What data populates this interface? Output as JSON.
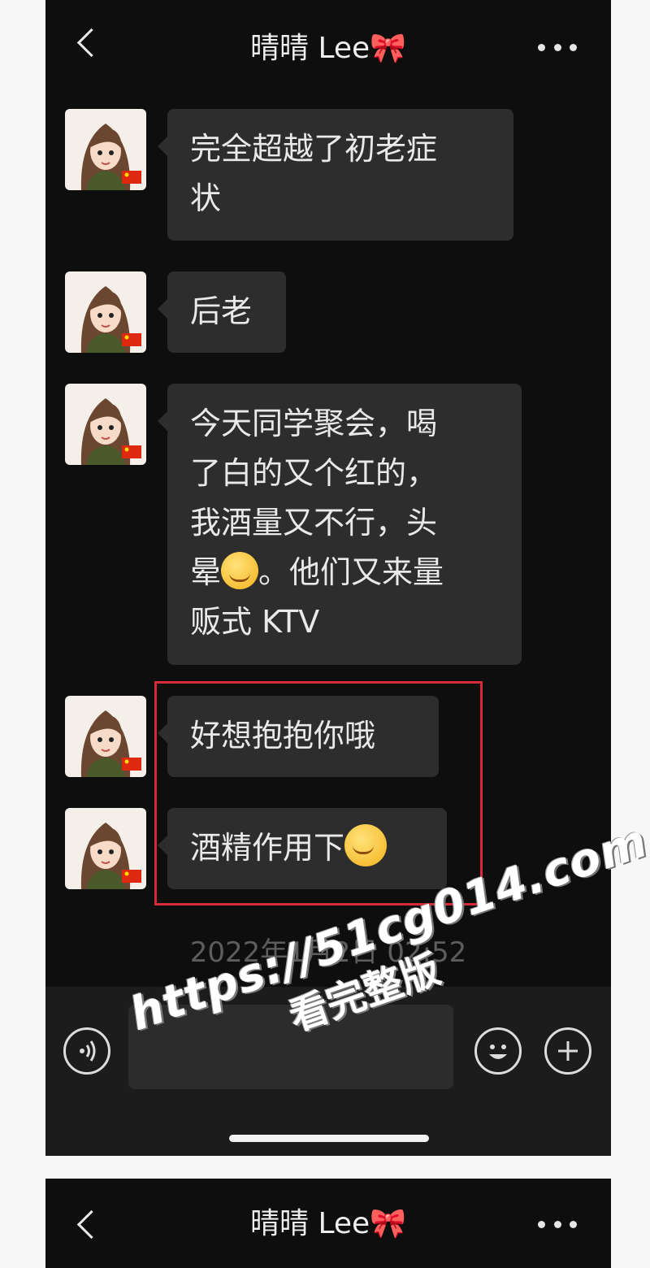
{
  "chat": {
    "title": "晴晴 Lee🎀",
    "messages": [
      {
        "text": "完全超越了初老症\n状"
      },
      {
        "text": "后老"
      },
      {
        "text_before": "今天同学聚会，喝\n了白的又个红的，\n我酒量又不行，头\n晕",
        "emoji": "dizzy-face-emoji",
        "text_after": "。他们又来量\n贩式 KTV"
      },
      {
        "text": "好想抱抱你哦"
      },
      {
        "text": "酒精作用下",
        "emoji": "blushing-smile-emoji"
      }
    ],
    "timestamp": "2022年1月2日 02:52"
  },
  "input_bar": {
    "voice_icon": "voice-input-icon",
    "emoji_icon": "emoji-face-icon",
    "plus_icon": "plus-icon"
  },
  "watermark": {
    "url": "https://51cg014.com",
    "subtitle": "看完整版"
  },
  "second_chat": {
    "title": "晴晴 Lee🎀"
  },
  "colors": {
    "background": "#0e0e0e",
    "bubble": "#2d2d2d",
    "highlight_border": "#d62a3b"
  }
}
